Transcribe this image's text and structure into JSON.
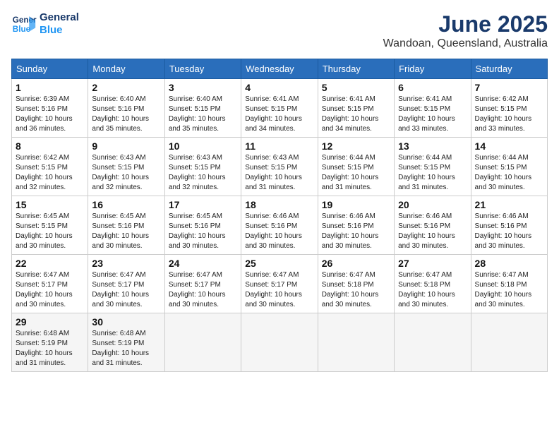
{
  "logo": {
    "line1": "General",
    "line2": "Blue"
  },
  "title": "June 2025",
  "location": "Wandoan, Queensland, Australia",
  "weekdays": [
    "Sunday",
    "Monday",
    "Tuesday",
    "Wednesday",
    "Thursday",
    "Friday",
    "Saturday"
  ],
  "weeks": [
    [
      {
        "day": "1",
        "sunrise": "6:39 AM",
        "sunset": "5:16 PM",
        "daylight": "10 hours and 36 minutes."
      },
      {
        "day": "2",
        "sunrise": "6:40 AM",
        "sunset": "5:16 PM",
        "daylight": "10 hours and 35 minutes."
      },
      {
        "day": "3",
        "sunrise": "6:40 AM",
        "sunset": "5:15 PM",
        "daylight": "10 hours and 35 minutes."
      },
      {
        "day": "4",
        "sunrise": "6:41 AM",
        "sunset": "5:15 PM",
        "daylight": "10 hours and 34 minutes."
      },
      {
        "day": "5",
        "sunrise": "6:41 AM",
        "sunset": "5:15 PM",
        "daylight": "10 hours and 34 minutes."
      },
      {
        "day": "6",
        "sunrise": "6:41 AM",
        "sunset": "5:15 PM",
        "daylight": "10 hours and 33 minutes."
      },
      {
        "day": "7",
        "sunrise": "6:42 AM",
        "sunset": "5:15 PM",
        "daylight": "10 hours and 33 minutes."
      }
    ],
    [
      {
        "day": "8",
        "sunrise": "6:42 AM",
        "sunset": "5:15 PM",
        "daylight": "10 hours and 32 minutes."
      },
      {
        "day": "9",
        "sunrise": "6:43 AM",
        "sunset": "5:15 PM",
        "daylight": "10 hours and 32 minutes."
      },
      {
        "day": "10",
        "sunrise": "6:43 AM",
        "sunset": "5:15 PM",
        "daylight": "10 hours and 32 minutes."
      },
      {
        "day": "11",
        "sunrise": "6:43 AM",
        "sunset": "5:15 PM",
        "daylight": "10 hours and 31 minutes."
      },
      {
        "day": "12",
        "sunrise": "6:44 AM",
        "sunset": "5:15 PM",
        "daylight": "10 hours and 31 minutes."
      },
      {
        "day": "13",
        "sunrise": "6:44 AM",
        "sunset": "5:15 PM",
        "daylight": "10 hours and 31 minutes."
      },
      {
        "day": "14",
        "sunrise": "6:44 AM",
        "sunset": "5:15 PM",
        "daylight": "10 hours and 30 minutes."
      }
    ],
    [
      {
        "day": "15",
        "sunrise": "6:45 AM",
        "sunset": "5:15 PM",
        "daylight": "10 hours and 30 minutes."
      },
      {
        "day": "16",
        "sunrise": "6:45 AM",
        "sunset": "5:16 PM",
        "daylight": "10 hours and 30 minutes."
      },
      {
        "day": "17",
        "sunrise": "6:45 AM",
        "sunset": "5:16 PM",
        "daylight": "10 hours and 30 minutes."
      },
      {
        "day": "18",
        "sunrise": "6:46 AM",
        "sunset": "5:16 PM",
        "daylight": "10 hours and 30 minutes."
      },
      {
        "day": "19",
        "sunrise": "6:46 AM",
        "sunset": "5:16 PM",
        "daylight": "10 hours and 30 minutes."
      },
      {
        "day": "20",
        "sunrise": "6:46 AM",
        "sunset": "5:16 PM",
        "daylight": "10 hours and 30 minutes."
      },
      {
        "day": "21",
        "sunrise": "6:46 AM",
        "sunset": "5:16 PM",
        "daylight": "10 hours and 30 minutes."
      }
    ],
    [
      {
        "day": "22",
        "sunrise": "6:47 AM",
        "sunset": "5:17 PM",
        "daylight": "10 hours and 30 minutes."
      },
      {
        "day": "23",
        "sunrise": "6:47 AM",
        "sunset": "5:17 PM",
        "daylight": "10 hours and 30 minutes."
      },
      {
        "day": "24",
        "sunrise": "6:47 AM",
        "sunset": "5:17 PM",
        "daylight": "10 hours and 30 minutes."
      },
      {
        "day": "25",
        "sunrise": "6:47 AM",
        "sunset": "5:17 PM",
        "daylight": "10 hours and 30 minutes."
      },
      {
        "day": "26",
        "sunrise": "6:47 AM",
        "sunset": "5:18 PM",
        "daylight": "10 hours and 30 minutes."
      },
      {
        "day": "27",
        "sunrise": "6:47 AM",
        "sunset": "5:18 PM",
        "daylight": "10 hours and 30 minutes."
      },
      {
        "day": "28",
        "sunrise": "6:47 AM",
        "sunset": "5:18 PM",
        "daylight": "10 hours and 30 minutes."
      }
    ],
    [
      {
        "day": "29",
        "sunrise": "6:48 AM",
        "sunset": "5:19 PM",
        "daylight": "10 hours and 31 minutes."
      },
      {
        "day": "30",
        "sunrise": "6:48 AM",
        "sunset": "5:19 PM",
        "daylight": "10 hours and 31 minutes."
      },
      null,
      null,
      null,
      null,
      null
    ]
  ]
}
